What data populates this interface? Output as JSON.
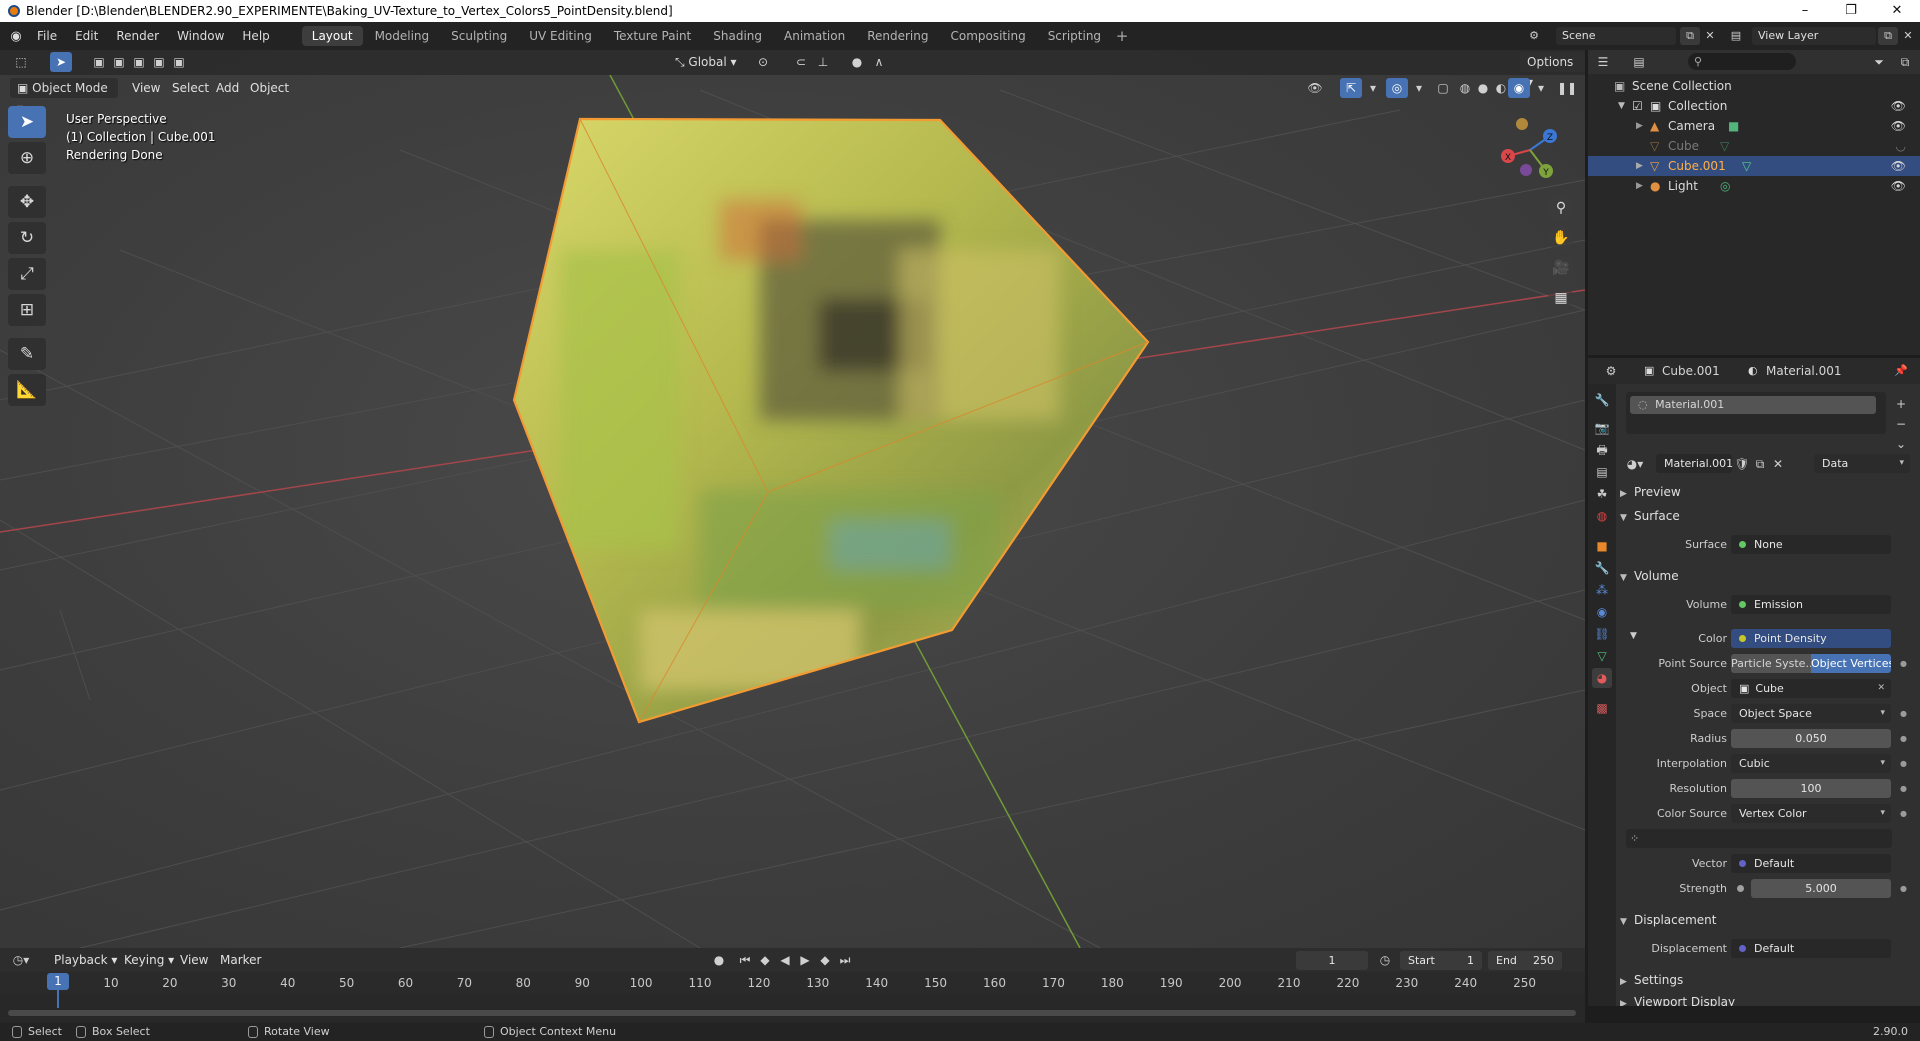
{
  "window": {
    "title": "Blender [D:\\Blender\\BLENDER2.90_EXPERIMENTE\\Baking_UV-Texture_to_Vertex_Colors5_PointDensity.blend]",
    "controls": [
      "–",
      "❐",
      "✕"
    ]
  },
  "menu": [
    "File",
    "Edit",
    "Render",
    "Window",
    "Help"
  ],
  "workspaces": [
    {
      "label": "Layout",
      "active": true
    },
    {
      "label": "Modeling"
    },
    {
      "label": "Sculpting"
    },
    {
      "label": "UV Editing"
    },
    {
      "label": "Texture Paint"
    },
    {
      "label": "Shading"
    },
    {
      "label": "Animation"
    },
    {
      "label": "Rendering"
    },
    {
      "label": "Compositing"
    },
    {
      "label": "Scripting"
    }
  ],
  "scene": "Scene",
  "view_layer": "View Layer",
  "viewport": {
    "mode": "Object Mode",
    "menus": [
      "View",
      "Select",
      "Add",
      "Object"
    ],
    "transform_orientation": "Global",
    "options": "Options",
    "overlay_lines": [
      "User Perspective",
      "(1) Collection | Cube.001",
      "Rendering Done"
    ],
    "gizmo_axes": {
      "x": "X",
      "y": "Y",
      "z": "Z"
    },
    "colors": {
      "x_axis": "#d9474a",
      "y_axis": "#7ea33a",
      "z_axis": "#3b78d6",
      "selection": "#f39b33"
    }
  },
  "outliner": {
    "root": "Scene Collection",
    "rows": [
      {
        "name": "Collection",
        "indent": 1
      },
      {
        "name": "Camera",
        "indent": 2
      },
      {
        "name": "Cube",
        "indent": 2,
        "hidden": true
      },
      {
        "name": "Cube.001",
        "indent": 2,
        "selected": true
      },
      {
        "name": "Light",
        "indent": 2
      }
    ]
  },
  "properties": {
    "object": "Cube.001",
    "material": "Material.001",
    "slot": "Material.001",
    "material_field": "Material.001",
    "link": "Data",
    "panels": {
      "preview": "Preview",
      "surface": "Surface",
      "volume": "Volume",
      "displacement": "Displacement",
      "settings": "Settings",
      "viewport_display": "Viewport Display"
    },
    "surface": {
      "label": "Surface",
      "value": "None"
    },
    "volume": {
      "label": "Volume",
      "value": "Emission"
    },
    "color": {
      "label": "Color",
      "value": "Point Density"
    },
    "point_source": {
      "label": "Point Source",
      "option1": "Particle Syste...",
      "option2": "Object Vertices"
    },
    "object_field": {
      "label": "Object",
      "value": "Cube"
    },
    "space": {
      "label": "Space",
      "value": "Object Space"
    },
    "radius": {
      "label": "Radius",
      "value": "0.050"
    },
    "interpolation": {
      "label": "Interpolation",
      "value": "Cubic"
    },
    "resolution": {
      "label": "Resolution",
      "value": "100"
    },
    "color_source": {
      "label": "Color Source",
      "value": "Vertex Color"
    },
    "vector": {
      "label": "Vector",
      "value": "Default"
    },
    "strength": {
      "label": "Strength",
      "value": "5.000"
    },
    "displacement_field": {
      "label": "Displacement",
      "value": "Default"
    }
  },
  "timeline": {
    "menus": [
      "Playback",
      "Keying",
      "View",
      "Marker"
    ],
    "current_frame": "1",
    "start_label": "Start",
    "start": "1",
    "end_label": "End",
    "end": "250",
    "ticks": [
      "10",
      "20",
      "30",
      "40",
      "50",
      "60",
      "70",
      "80",
      "90",
      "100",
      "110",
      "120",
      "130",
      "140",
      "150",
      "160",
      "170",
      "180",
      "190",
      "200",
      "210",
      "220",
      "230",
      "240",
      "250"
    ]
  },
  "status": {
    "select": "Select",
    "box_select": "Box Select",
    "rotate_view": "Rotate View",
    "context_menu": "Object Context Menu",
    "version": "2.90.0"
  }
}
